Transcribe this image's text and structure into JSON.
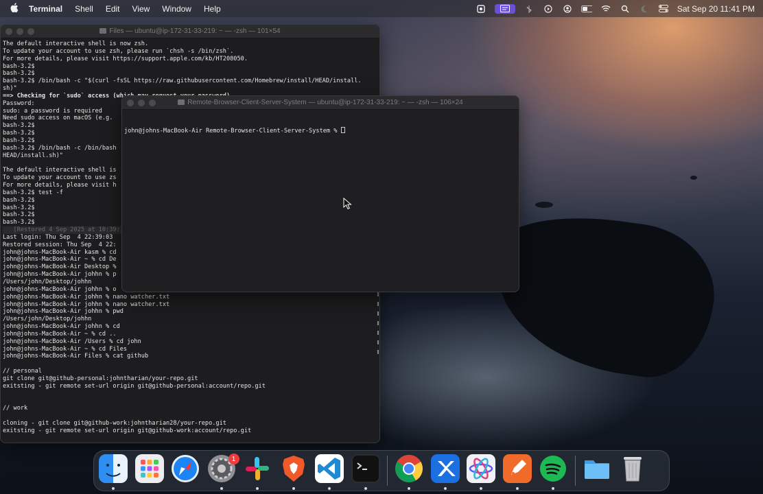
{
  "menubar": {
    "app_name": "Terminal",
    "menus": [
      "Shell",
      "Edit",
      "View",
      "Window",
      "Help"
    ],
    "status_icons": [
      "screen-recorder-icon",
      "screen-mirroring-icon",
      "bluetooth-off-icon",
      "play-icon",
      "user-icon",
      "battery-icon",
      "wifi-icon",
      "search-icon",
      "do-not-disturb-icon",
      "control-center-icon"
    ],
    "clock": "Sat Sep 20  11:41 PM"
  },
  "back_window": {
    "title": "Files — ubuntu@ip-172-31-33-219: ~ — -zsh — 101×54",
    "lines": [
      "The default interactive shell is now zsh.",
      "To update your account to use zsh, please run `chsh -s /bin/zsh`.",
      "For more details, please visit https://support.apple.com/kb/HT208050.",
      "bash-3.2$",
      "bash-3.2$",
      "bash-3.2$ /bin/bash -c \"$(curl -fsSL https://raw.githubusercontent.com/Homebrew/install/HEAD/install.",
      "sh)\"",
      "==> Checking for `sudo` access (which may request your password)...",
      "Password:",
      "sudo: a password is required",
      "Need sudo access on macOS (e.g.",
      "bash-3.2$",
      "bash-3.2$",
      "bash-3.2$",
      "bash-3.2$ /bin/bash -c /bin/bash",
      "HEAD/install.sh)\"",
      "",
      "The default interactive shell is",
      "To update your account to use zs",
      "For more details, please visit h",
      "bash-3.2$ test -f",
      "bash-3.2$",
      "bash-3.2$",
      "bash-3.2$",
      "bash-3.2$",
      "   [Restored 4 Sep 2025 at 10:39:",
      "Last login: Thu Sep  4 22:39:03",
      "Restored session: Thu Sep  4 22:",
      "john@johns-MacBook-Air kasm % cd",
      "john@johns-MacBook-Air ~ % cd De",
      "john@johns-MacBook-Air Desktop %",
      "john@johns-MacBook-Air johhn % p",
      "/Users/john/Desktop/johhn",
      "john@johns-MacBook-Air johhn % o",
      "john@johns-MacBook-Air johhn % nano watcher.txt",
      "john@johns-MacBook-Air johhn % nano watcher.txt",
      "john@johns-MacBook-Air johhn % pwd",
      "/Users/john/Desktop/johhn",
      "john@johns-MacBook-Air johhn % cd",
      "john@johns-MacBook-Air ~ % cd ..",
      "john@johns-MacBook-Air /Users % cd john",
      "john@johns-MacBook-Air ~ % cd Files",
      "john@johns-MacBook-Air Files % cat github",
      "",
      "// personal",
      "git clone git@github-personal:johntharian/your-repo.git",
      "exitsting - git remote set-url origin git@github-personal:account/repo.git",
      "",
      "",
      "// work",
      "",
      "cloning - git clone git@github-work:johntharian28/your-repo.git",
      "exitsting - git remote set-url origin git@github-work:account/repo.git"
    ]
  },
  "front_window": {
    "title": "Remote-Browser-Client-Server-System — ubuntu@ip-172-31-33-219: ~ — -zsh — 106×24",
    "prompt": "john@johns-MacBook-Air Remote-Browser-Client-Server-System % "
  },
  "dock": {
    "items": [
      {
        "name": "finder",
        "label": "Finder",
        "color": "#2f8ff0",
        "running": true
      },
      {
        "name": "launchpad",
        "label": "Launchpad",
        "color": "#e9e9ee",
        "running": false
      },
      {
        "name": "safari",
        "label": "Safari",
        "color": "#1c84f5",
        "running": false
      },
      {
        "name": "system-settings",
        "label": "System Settings",
        "color": "#8e8e93",
        "running": true,
        "badge": "1"
      },
      {
        "name": "slack",
        "label": "Slack",
        "color": "#ffffff",
        "running": true
      },
      {
        "name": "brave",
        "label": "Brave",
        "color": "#f0592a",
        "running": true
      },
      {
        "name": "vscode",
        "label": "VS Code",
        "color": "#1f8ad2",
        "running": true
      },
      {
        "name": "terminal",
        "label": "Terminal",
        "color": "#1c1c1e",
        "running": true
      },
      {
        "name": "chrome",
        "label": "Chrome",
        "color": "#ffffff",
        "running": true
      },
      {
        "name": "xcode",
        "label": "Xcode",
        "color": "#3b8cf0",
        "running": true
      },
      {
        "name": "electron-app",
        "label": "App",
        "color": "#f0f0f5",
        "running": true
      },
      {
        "name": "pen-app",
        "label": "Pen",
        "color": "#f06a2a",
        "running": true
      },
      {
        "name": "spotify",
        "label": "Spotify",
        "color": "#1db954",
        "running": true
      },
      {
        "name": "folder",
        "label": "Folder",
        "color": "#58b2f2",
        "running": false
      },
      {
        "name": "trash",
        "label": "Trash",
        "color": "#c8c8cc",
        "running": false
      }
    ]
  }
}
